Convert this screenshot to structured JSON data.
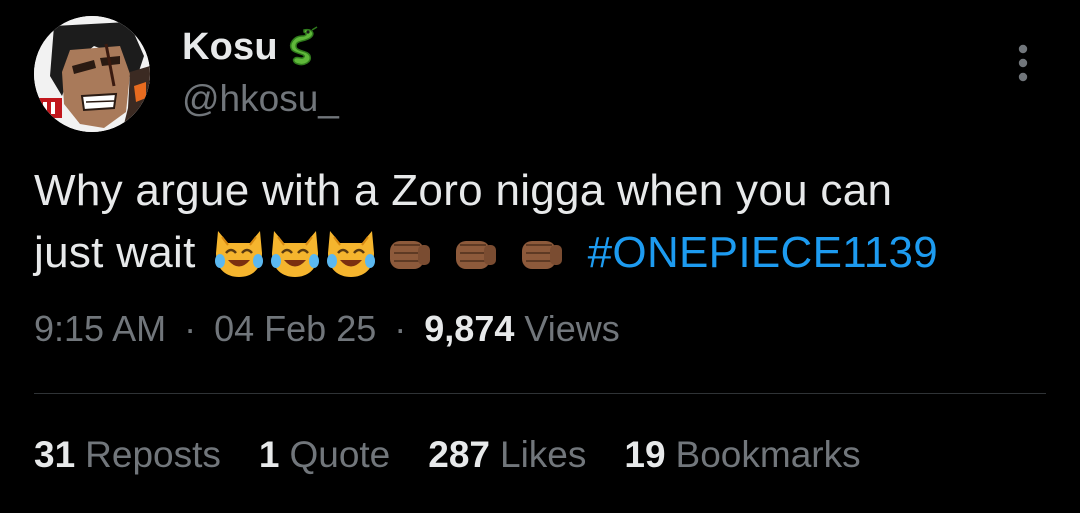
{
  "author": {
    "display_name": "Kosu",
    "handle": "@hkosu_",
    "name_badge_icon": "dragon-emoji-icon",
    "avatar_icon": "profile-avatar-anime-character"
  },
  "tweet": {
    "line1": "Why argue with a Zoro nigga when you can",
    "line2_text": "just wait",
    "emojis": [
      "joy-cat-emoji",
      "joy-cat-emoji",
      "joy-cat-emoji",
      "fist-bump-emoji",
      "fist-bump-emoji",
      "fist-bump-emoji"
    ],
    "hashtag": "#ONEPIECE1139"
  },
  "meta": {
    "time": "9:15 AM",
    "separator": "·",
    "date": "04 Feb 25",
    "views_count": "9,874",
    "views_label": "Views"
  },
  "stats": {
    "reposts_count": "31",
    "reposts_label": "Reposts",
    "quotes_count": "1",
    "quotes_label": "Quote",
    "likes_count": "287",
    "likes_label": "Likes",
    "bookmarks_count": "19",
    "bookmarks_label": "Bookmarks"
  },
  "colors": {
    "background": "#000000",
    "primary_text": "#e7e9ea",
    "secondary_text": "#71767b",
    "link": "#1d9bf0",
    "divider": "#2f3336"
  }
}
